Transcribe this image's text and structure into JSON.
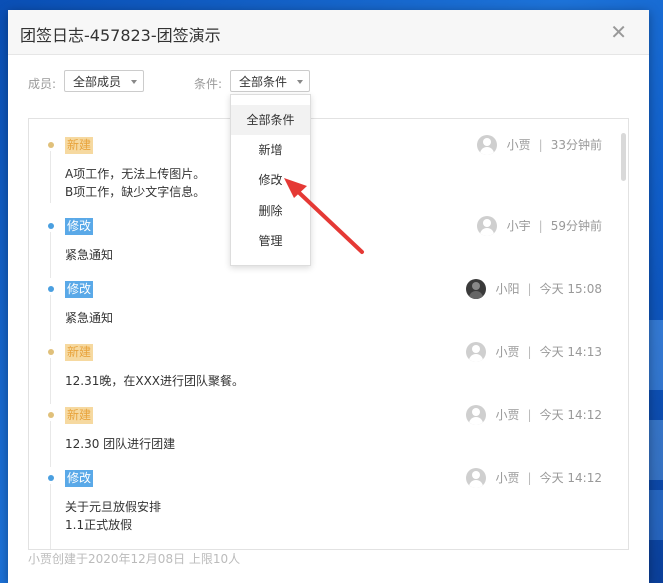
{
  "colors": {
    "accent_red": "#e53935",
    "tag_new": "#e8a33c",
    "tag_modify": "#5aa9e8"
  },
  "dialog": {
    "title": "团签日志-457823-团签演示",
    "close_icon": "close-icon"
  },
  "filters": {
    "member_label": "成员:",
    "member_value": "全部成员",
    "condition_label": "条件:",
    "condition_value": "全部条件"
  },
  "dropdown": {
    "items": [
      "全部条件",
      "新增",
      "修改",
      "删除",
      "管理"
    ],
    "selected_index": 0
  },
  "entries": [
    {
      "tag": "新建",
      "kind": "new",
      "user": "小贾",
      "time": "33分钟前",
      "lines": [
        "A项工作，无法上传图片。",
        "B项工作，缺少文字信息。"
      ]
    },
    {
      "tag": "修改",
      "kind": "mod",
      "user": "小宇",
      "time": "59分钟前",
      "lines": [
        "紧急通知"
      ]
    },
    {
      "tag": "修改",
      "kind": "mod",
      "user": "小阳",
      "time": "今天 15:08",
      "lines": [
        "紧急通知"
      ]
    },
    {
      "tag": "新建",
      "kind": "new",
      "user": "小贾",
      "time": "今天 14:13",
      "lines": [
        "12.31晚，在XXX进行团队聚餐。"
      ]
    },
    {
      "tag": "新建",
      "kind": "new",
      "user": "小贾",
      "time": "今天 14:12",
      "lines": [
        "12.30  团队进行团建"
      ]
    },
    {
      "tag": "修改",
      "kind": "mod",
      "user": "小贾",
      "time": "今天 14:12",
      "lines": [
        "关于元旦放假安排",
        "1.1正式放假"
      ]
    }
  ],
  "footer": {
    "text": "小贾创建于2020年12月08日  上限10人"
  }
}
